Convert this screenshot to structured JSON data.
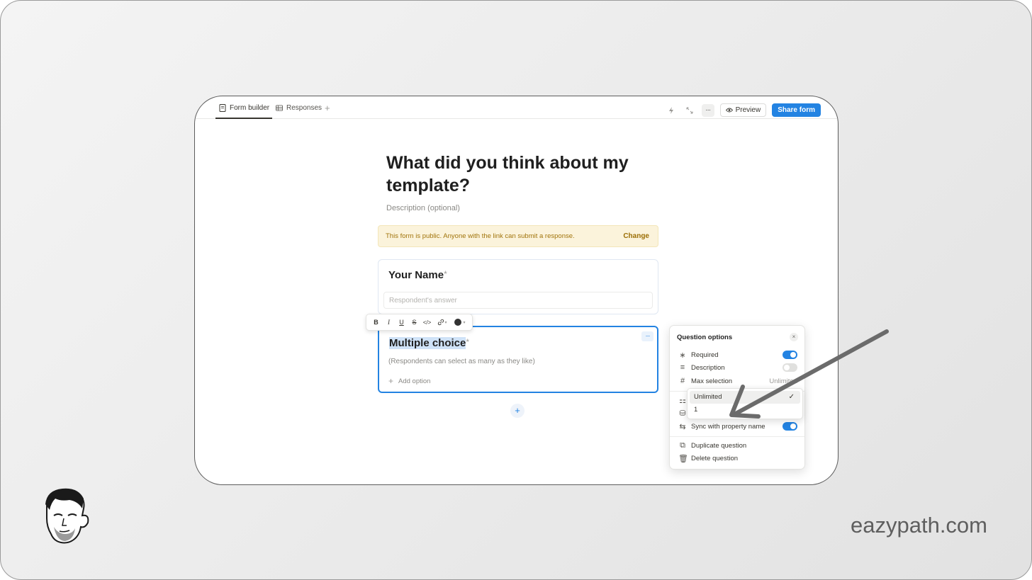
{
  "tabs": [
    {
      "label": "Form builder",
      "icon": "document-icon",
      "active": true
    },
    {
      "label": "Responses",
      "icon": "table-icon",
      "active": false
    }
  ],
  "toolbar": {
    "preview_label": "Preview",
    "share_label": "Share form",
    "more_label": "···"
  },
  "form": {
    "title": "What did you think about my template?",
    "description_placeholder": "Description (optional)"
  },
  "notice": {
    "text": "This form is public. Anyone with the link can submit a response.",
    "action": "Change"
  },
  "questions": [
    {
      "title": "Your Name",
      "required_mark": "*",
      "answer_placeholder": "Respondent's answer"
    },
    {
      "title": "Multiple choice",
      "required_mark": "*",
      "subtitle": "(Respondents can select as many as they like)",
      "add_option_label": "Add option"
    }
  ],
  "format_bar": {
    "bold": "B",
    "italic": "I",
    "underline": "U",
    "strike": "S",
    "code": "</>"
  },
  "options_panel": {
    "title": "Question options",
    "close": "×",
    "rows": [
      {
        "label": "Required",
        "toggle": true
      },
      {
        "label": "Description",
        "toggle": false
      },
      {
        "label": "Max selection",
        "value": "Unlimited"
      },
      {
        "label": "Sync with property name",
        "toggle": true
      }
    ],
    "actions": [
      {
        "label": "Duplicate question"
      },
      {
        "label": "Delete question"
      }
    ]
  },
  "max_selection_dropdown": {
    "options": [
      "Unlimited",
      "1"
    ],
    "selected": "Unlimited",
    "check": "✓"
  },
  "brand": "eazypath.com",
  "colors": {
    "accent": "#2383e2",
    "notice_bg": "#fbf3db",
    "notice_text": "#a1740b",
    "arrow": "#6b6b6b"
  }
}
